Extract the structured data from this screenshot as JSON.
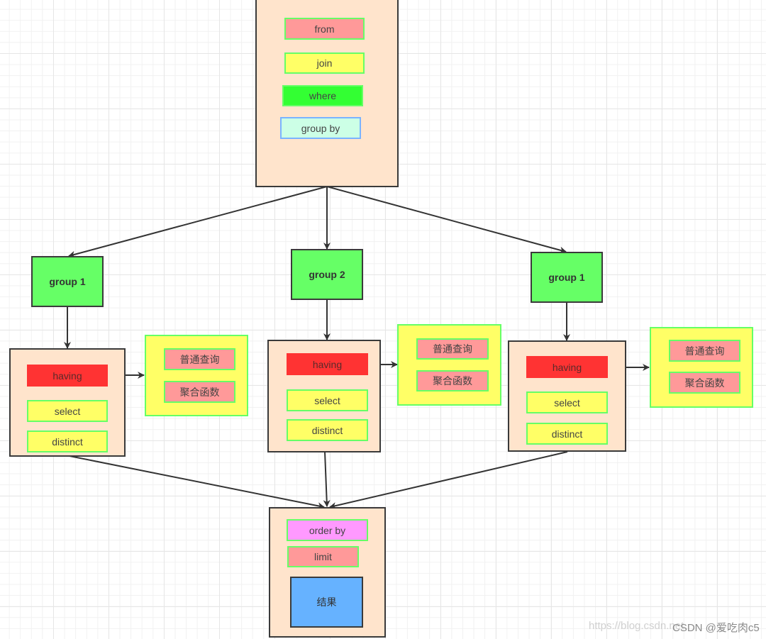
{
  "top_box": {
    "items": [
      "from",
      "join",
      "where",
      "group by"
    ]
  },
  "groups": [
    {
      "label": "group 1",
      "having": "having",
      "select": "select",
      "distinct": "distinct",
      "side": [
        "普通查询",
        "聚合函数"
      ]
    },
    {
      "label": "group 2",
      "having": "having",
      "select": "select",
      "distinct": "distinct",
      "side": [
        "普通查询",
        "聚合函数"
      ]
    },
    {
      "label": "group 1",
      "having": "having",
      "select": "select",
      "distinct": "distinct",
      "side": [
        "普通查询",
        "聚合函数"
      ]
    }
  ],
  "bottom_box": {
    "order_by": "order by",
    "limit": "limit",
    "result": "结果"
  },
  "watermark": {
    "url": "https://blog.csdn.net",
    "brand": "CSDN @爱吃肉c5"
  },
  "colors": {
    "container": "#ffe4cc",
    "group": "#66ff66",
    "having": "#ff3333",
    "chip_red": "#ff9999",
    "chip_yellow": "#ffff66",
    "where": "#33ff33",
    "group_by": "#ccffe6",
    "order_by": "#ff99ff",
    "result": "#66b2ff"
  }
}
